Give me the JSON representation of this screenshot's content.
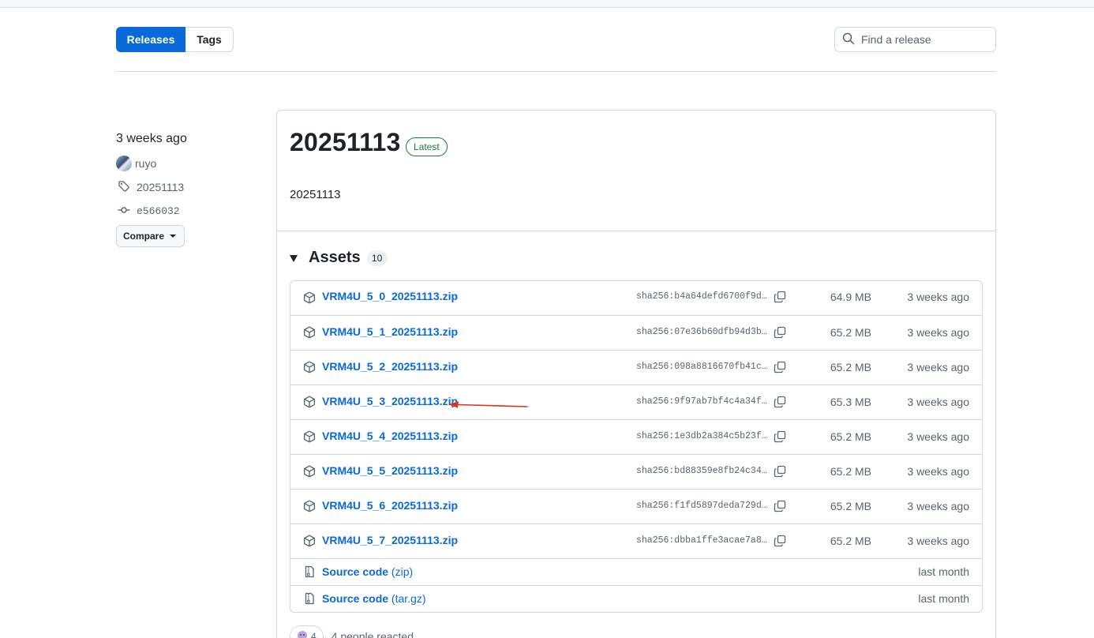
{
  "tabs": {
    "releases_label": "Releases",
    "tags_label": "Tags"
  },
  "search": {
    "placeholder": "Find a release"
  },
  "sidebar": {
    "published": "3 weeks ago",
    "author": "ruyo",
    "tag": "20251113",
    "commit": "e566032",
    "compare_label": "Compare"
  },
  "release": {
    "title": "20251113",
    "badge": "Latest",
    "body": "20251113"
  },
  "assets": {
    "label": "Assets",
    "count": "10",
    "files": [
      {
        "name": "VRM4U_5_0_20251113.zip",
        "sha": "sha256:b4a64defd6700f9d3…",
        "size": "64.9 MB",
        "date": "3 weeks ago"
      },
      {
        "name": "VRM4U_5_1_20251113.zip",
        "sha": "sha256:07e36b60dfb94d3be…",
        "size": "65.2 MB",
        "date": "3 weeks ago"
      },
      {
        "name": "VRM4U_5_2_20251113.zip",
        "sha": "sha256:098a8816670fb41ca…",
        "size": "65.2 MB",
        "date": "3 weeks ago"
      },
      {
        "name": "VRM4U_5_3_20251113.zip",
        "sha": "sha256:9f97ab7bf4c4a34f5…",
        "size": "65.3 MB",
        "date": "3 weeks ago"
      },
      {
        "name": "VRM4U_5_4_20251113.zip",
        "sha": "sha256:1e3db2a384c5b23f8…",
        "size": "65.2 MB",
        "date": "3 weeks ago"
      },
      {
        "name": "VRM4U_5_5_20251113.zip",
        "sha": "sha256:bd88359e8fb24c342…",
        "size": "65.2 MB",
        "date": "3 weeks ago"
      },
      {
        "name": "VRM4U_5_6_20251113.zip",
        "sha": "sha256:f1fd5897deda729d7…",
        "size": "65.2 MB",
        "date": "3 weeks ago"
      },
      {
        "name": "VRM4U_5_7_20251113.zip",
        "sha": "sha256:dbba1ffe3acae7a86…",
        "size": "65.2 MB",
        "date": "3 weeks ago"
      }
    ],
    "source": [
      {
        "name": "Source code",
        "format": "(zip)",
        "date": "last month"
      },
      {
        "name": "Source code",
        "format": "(tar.gz)",
        "date": "last month"
      }
    ]
  },
  "reactions": {
    "count": "4",
    "text": "4 people reacted"
  },
  "colors": {
    "accent": "#0969da",
    "latest": "#1a7f37",
    "annotation_arrow": "#d9341f"
  }
}
